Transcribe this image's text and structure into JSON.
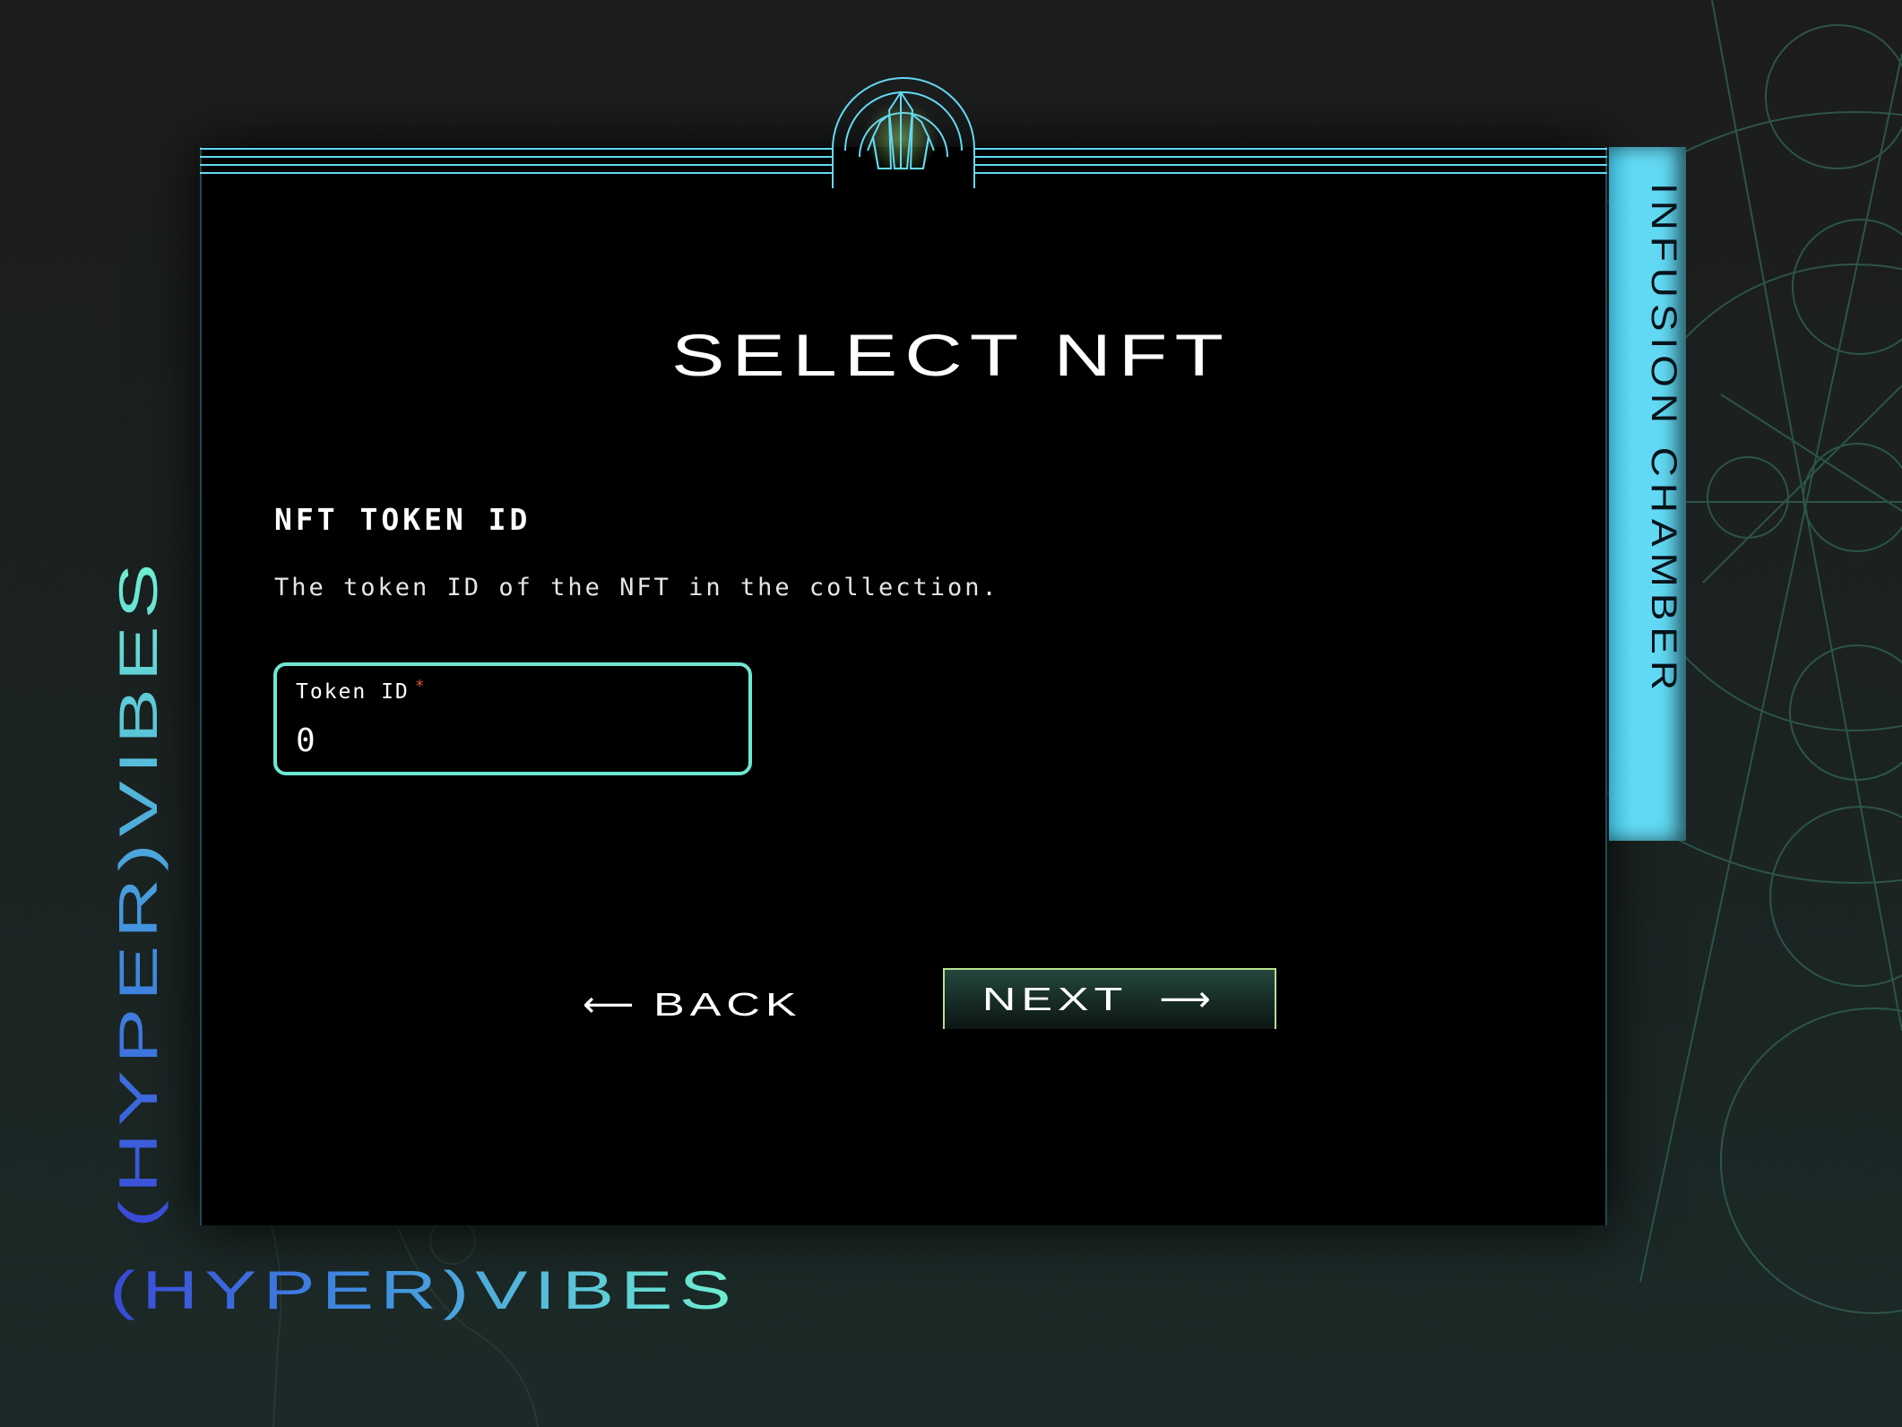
{
  "app": {
    "side_tab_label": "INFUSION CHAMBER",
    "brand_horizontal": "(HYPER)VIBES",
    "brand_vertical": "(HYPER)VIBES"
  },
  "page": {
    "title": "SELECT NFT"
  },
  "form": {
    "heading": "NFT TOKEN ID",
    "description": "The token ID of the NFT in the collection.",
    "token_field": {
      "label": "Token ID",
      "required_mark": "*",
      "value": "0"
    }
  },
  "actions": {
    "back_arrow": "⟵",
    "back_label": "BACK",
    "next_label": "NEXT",
    "next_arrow": "⟶"
  },
  "icons": {
    "emblem": "crystal-icon"
  },
  "colors": {
    "accent_cyan": "#62d9f4",
    "field_border": "#6ee7d2",
    "next_border": "#b8e08e",
    "required": "#e0523f"
  }
}
